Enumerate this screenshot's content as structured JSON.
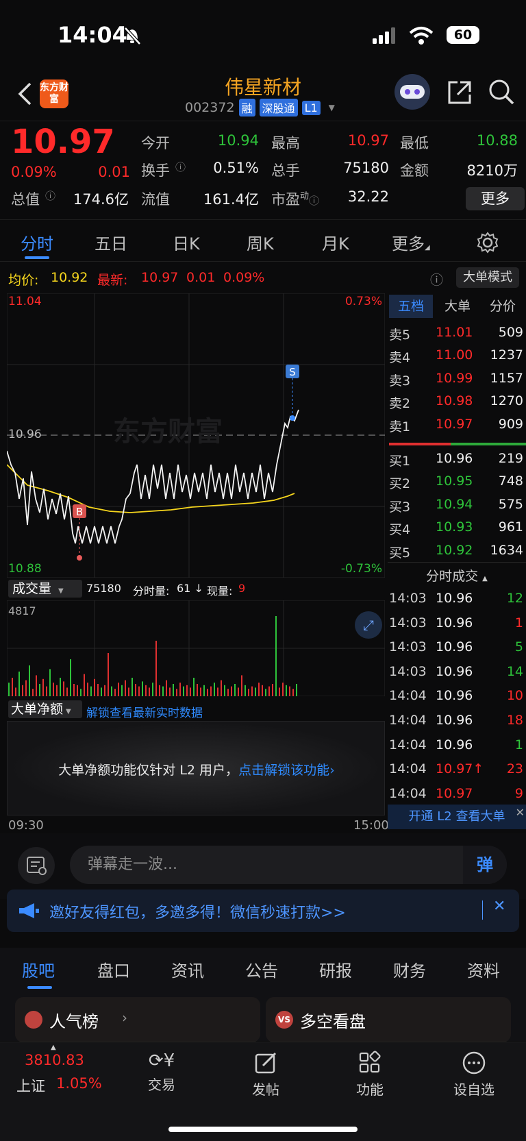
{
  "status_bar": {
    "time": "14:04",
    "battery": "60"
  },
  "header": {
    "logo_text": "东方财富",
    "stock_name": "伟星新材",
    "stock_code": "002372",
    "tags": [
      "融",
      "深股通",
      "L1"
    ]
  },
  "quote": {
    "price": "10.97",
    "change_pct": "0.09%",
    "change": "0.01",
    "fields": {
      "open_label": "今开",
      "open": "10.94",
      "high_label": "最高",
      "high": "10.97",
      "low_label": "最低",
      "low": "10.88",
      "turnover_label": "换手",
      "turnover": "0.51%",
      "volume_label": "总手",
      "volume": "75180",
      "amount_label": "金额",
      "amount": "8210万",
      "mktcap_label": "总值",
      "mktcap": "174.6亿",
      "float_label": "流值",
      "float": "161.4亿",
      "pe_label": "市盈",
      "pe_sup": "动",
      "pe": "32.22"
    },
    "more_label": "更多"
  },
  "chart_tabs": [
    "分时",
    "五日",
    "日K",
    "周K",
    "月K",
    "更多"
  ],
  "avg_row": {
    "avg_label": "均价:",
    "avg": "10.92",
    "latest_label": "最新:",
    "latest": "10.97",
    "latest_chg": "0.01",
    "latest_pct": "0.09%",
    "big_order_label": "大单模式"
  },
  "price_chart": {
    "y_top": "11.04",
    "y_bottom": "10.88",
    "pct_top": "0.73%",
    "pct_bottom": "-0.73%",
    "ref_price": "10.96",
    "buy_marker": "B",
    "sell_marker": "S",
    "watermark": "东方财富"
  },
  "volume_panel": {
    "selector_label": "成交量",
    "summary_total": "75180",
    "summary_minute_label": "分时量:",
    "summary_minute": "61 ↓",
    "summary_now_label": "现量:",
    "summary_now": "9",
    "max_label": "4817"
  },
  "net_panel": {
    "selector_label": "大单净额",
    "unlock_hint": "解锁查看最新实时数据",
    "notice": "大单净额功能仅针对 L2 用户，",
    "notice_link": "点击解锁该功能",
    "time_start": "09:30",
    "time_end": "15:00"
  },
  "order_book": {
    "tabs": [
      "五档",
      "大单",
      "分价"
    ],
    "asks": [
      {
        "label": "卖5",
        "price": "11.01",
        "vol": "509"
      },
      {
        "label": "卖4",
        "price": "11.00",
        "vol": "1237"
      },
      {
        "label": "卖3",
        "price": "10.99",
        "vol": "1157"
      },
      {
        "label": "卖2",
        "price": "10.98",
        "vol": "1270"
      },
      {
        "label": "卖1",
        "price": "10.97",
        "vol": "909"
      }
    ],
    "bids": [
      {
        "label": "买1",
        "price": "10.96",
        "vol": "219"
      },
      {
        "label": "买2",
        "price": "10.95",
        "vol": "748"
      },
      {
        "label": "买3",
        "price": "10.94",
        "vol": "575"
      },
      {
        "label": "买4",
        "price": "10.93",
        "vol": "961"
      },
      {
        "label": "买5",
        "price": "10.92",
        "vol": "1634"
      }
    ],
    "trades_title": "分时成交",
    "trades": [
      {
        "time": "14:03",
        "price": "10.96",
        "vol": "12"
      },
      {
        "time": "14:03",
        "price": "10.96",
        "vol": "1"
      },
      {
        "time": "14:03",
        "price": "10.96",
        "vol": "5"
      },
      {
        "time": "14:03",
        "price": "10.96",
        "vol": "14"
      },
      {
        "time": "14:04",
        "price": "10.96",
        "vol": "10"
      },
      {
        "time": "14:04",
        "price": "10.96",
        "vol": "18"
      },
      {
        "time": "14:04",
        "price": "10.96",
        "vol": "1"
      },
      {
        "time": "14:04",
        "price": "10.97↑",
        "vol": "23"
      },
      {
        "time": "14:04",
        "price": "10.97",
        "vol": "9"
      }
    ],
    "l2_banner": "开通 L2 查看大单"
  },
  "chat": {
    "placeholder": "弹幕走一波...",
    "send": "弹"
  },
  "banner": {
    "text": "邀好友得红包，多邀多得！微信秒速打款>>"
  },
  "content_tabs": [
    "股吧",
    "盘口",
    "资讯",
    "公告",
    "研报",
    "财务",
    "资料"
  ],
  "cards": [
    {
      "title": "人气榜",
      "icon": "chart-bar-icon"
    },
    {
      "title": "多空看盘",
      "icon": "vs-icon"
    }
  ],
  "bottom_nav": {
    "index_value": "3810.83",
    "index_name": "上证",
    "index_pct": "1.05%",
    "items": [
      "交易",
      "发帖",
      "功能",
      "设自选"
    ]
  },
  "colors": {
    "up": "#ff2a2a",
    "down": "#2ec33a",
    "accent": "#3b8bff",
    "avg_line": "#f5d51d",
    "brand": "#f5a522"
  }
}
